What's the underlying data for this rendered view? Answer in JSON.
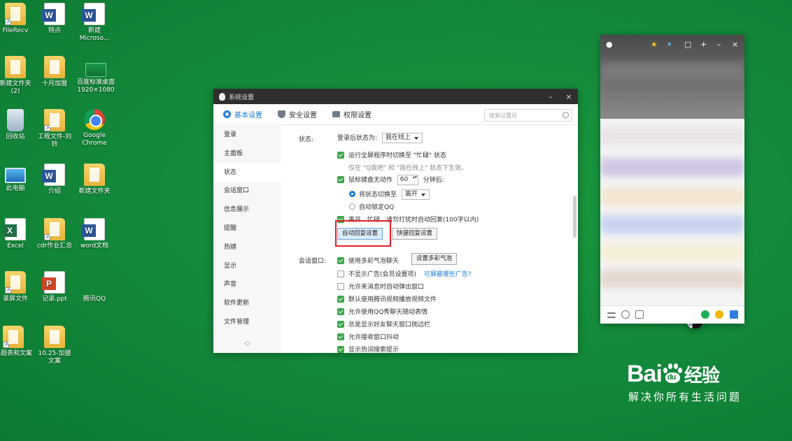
{
  "desktop": {
    "icons": [
      {
        "label": "FileRecv"
      },
      {
        "label": "特点"
      },
      {
        "label": "新建\nMicroso..."
      },
      {
        "label": "新建文件夹\n(2)"
      },
      {
        "label": "十月加盟"
      },
      {
        "label": "百度标准桌面\n1920×1080"
      },
      {
        "label": "回收站"
      },
      {
        "label": "工程文件-刘\n铃"
      },
      {
        "label": "Google\nChrome"
      },
      {
        "label": "此电脑"
      },
      {
        "label": "介绍"
      },
      {
        "label": "新建文件夹"
      },
      {
        "label": "Excel"
      },
      {
        "label": "cdr作业汇总"
      },
      {
        "label": "word文档"
      },
      {
        "label": "录屏文件"
      },
      {
        "label": "记录.ppt"
      },
      {
        "label": "腾讯QQ"
      },
      {
        "label": "课题表和文案"
      },
      {
        "label": "10.25-加盟\n文案"
      }
    ]
  },
  "window": {
    "title": "系统设置",
    "minimize": "–",
    "close": "×",
    "tabs": [
      {
        "label": "基本设置"
      },
      {
        "label": "安全设置"
      },
      {
        "label": "权限设置"
      }
    ],
    "search_placeholder": "搜索设置项"
  },
  "sidebar": {
    "items": [
      {
        "label": "登录"
      },
      {
        "label": "主面板"
      },
      {
        "label": "状态"
      },
      {
        "label": "会话窗口"
      },
      {
        "label": "信息展示"
      },
      {
        "label": "提醒"
      },
      {
        "label": "热键"
      },
      {
        "label": "显示"
      },
      {
        "label": "声音"
      },
      {
        "label": "软件更新"
      },
      {
        "label": "文件管理"
      }
    ],
    "more": "︿\n﹀"
  },
  "status_section": {
    "label": "状态:",
    "login_status_label": "登录后状态为:",
    "login_status_value": "我在线上",
    "fullscreen_busy": "运行全屏程序时切换至 \"忙碌\" 状态",
    "fullscreen_hint": "仅在 \"Q我吧\" 和 \"我在线上\" 状态下生效。",
    "idle_label": "鼠标键盘无动作",
    "idle_minutes": "60",
    "idle_unit": "分钟后:",
    "switch_status": "将状态切换至",
    "switch_value": "离开",
    "auto_lock": "自动锁定QQ",
    "auto_reply": "离开、忙碌、请勿打扰时自动回复(100字以内)",
    "auto_reply_button": "自动回复设置",
    "quick_reply_button": "快捷回复设置"
  },
  "session_section": {
    "label": "会话窗口:",
    "items": [
      {
        "label": "使用多彩气泡聊天",
        "checked": true
      },
      {
        "label": "不显示广告(会员设置项)",
        "checked": false
      },
      {
        "label": "允许来消息时自动弹出窗口",
        "checked": false
      },
      {
        "label": "默认使用腾讯视频播放视频文件",
        "checked": true
      },
      {
        "label": "允许使用QQ秀聊天随动表情",
        "checked": true
      },
      {
        "label": "总是显示好友聊天窗口侧边栏",
        "checked": true
      },
      {
        "label": "允许接收窗口抖动",
        "checked": true
      },
      {
        "label": "显示热词搜索提示",
        "checked": true
      }
    ],
    "bubble_button": "设置多彩气泡",
    "ads_link": "可屏蔽哪些广告?"
  },
  "watermark": {
    "brand_left": "Bai",
    "brand_right": "经验",
    "paw_text": "du",
    "slogan": "解决你所有生活问题"
  },
  "colors": {
    "desktop_bg": "#12883a",
    "accent": "#1c7bd6",
    "checkbox": "#3da64a",
    "highlight": "#e41f27"
  }
}
